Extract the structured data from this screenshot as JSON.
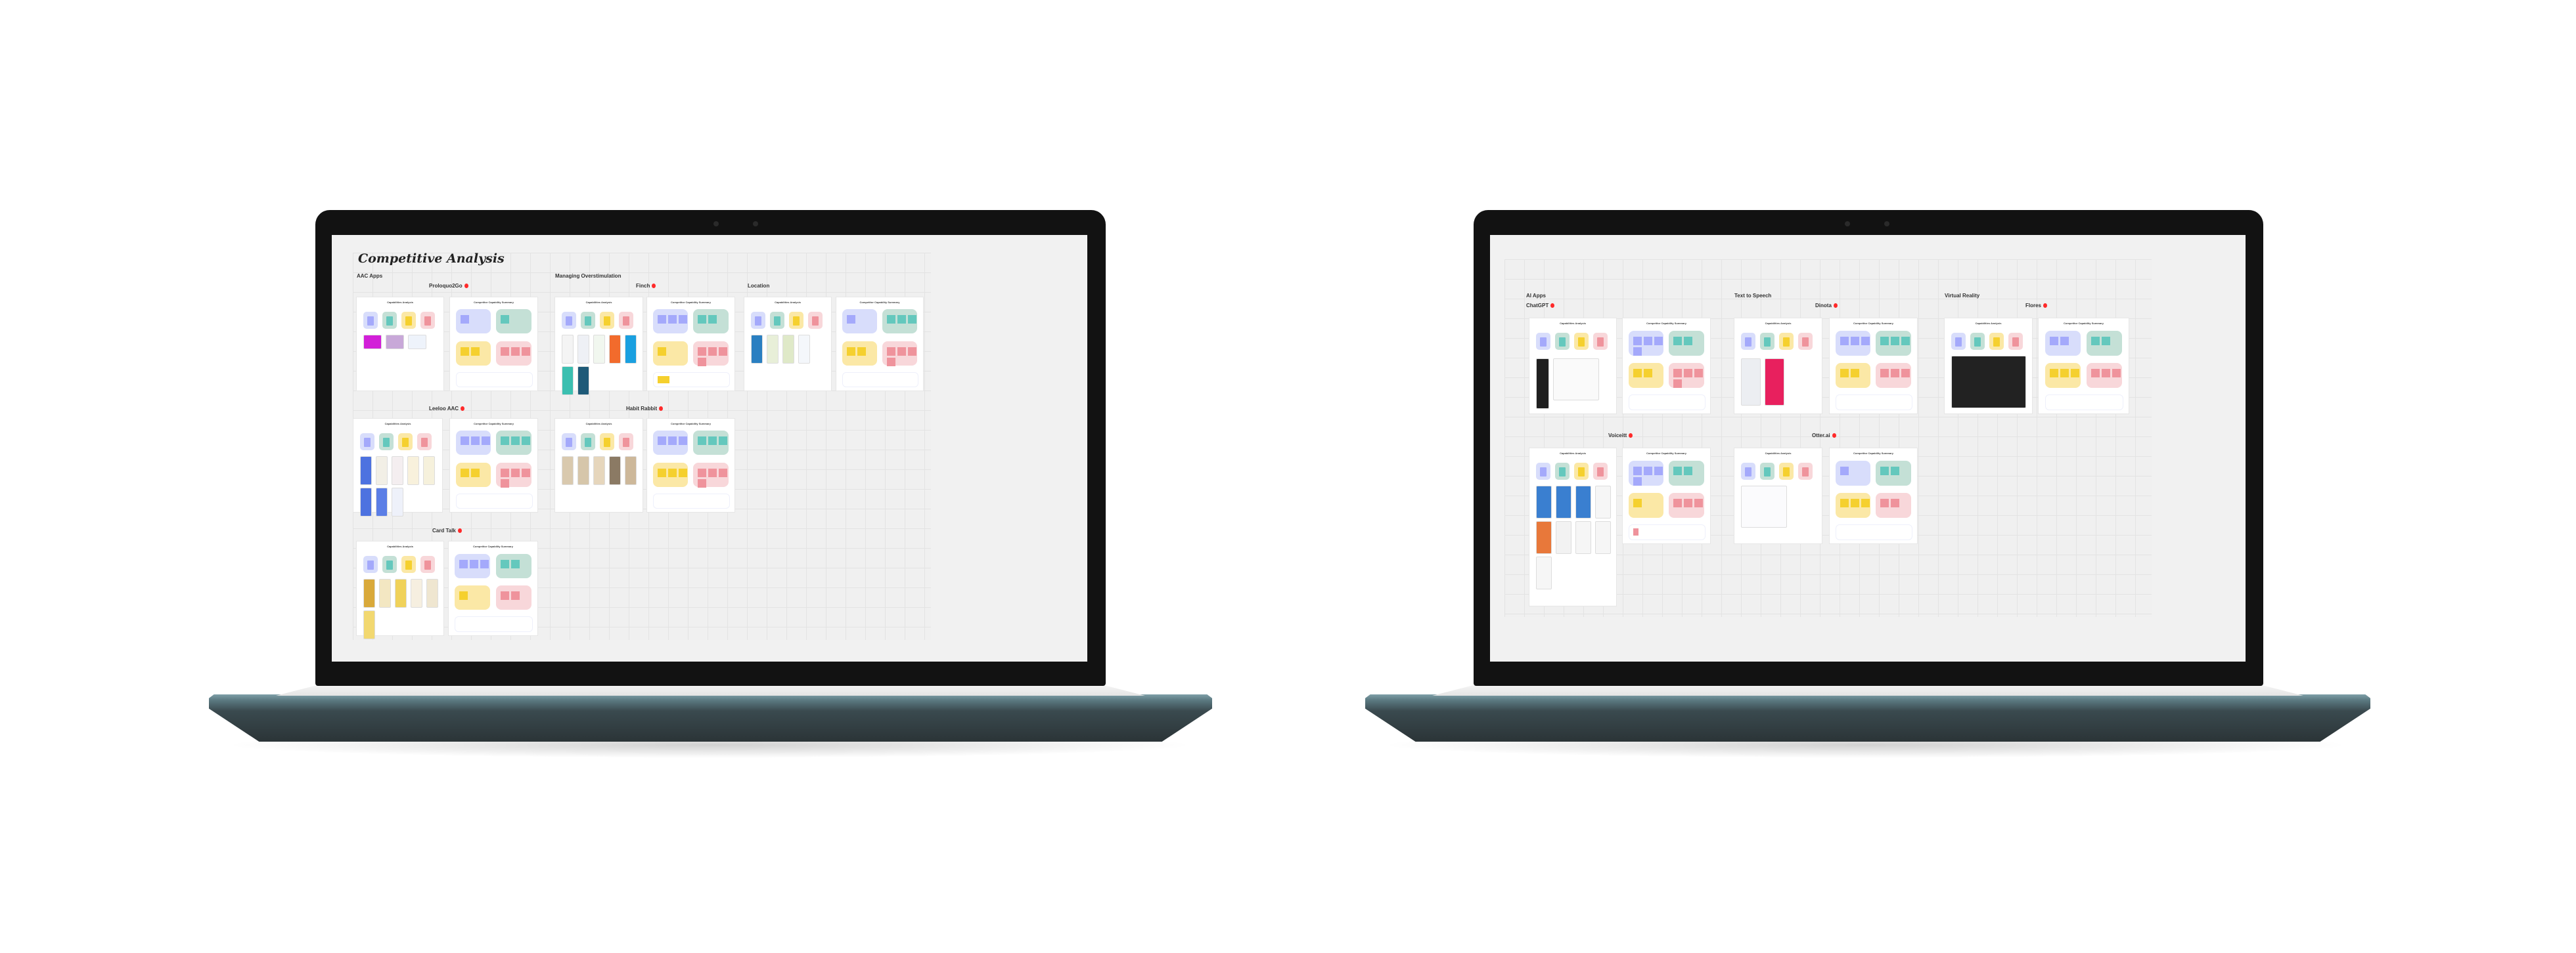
{
  "colors": {
    "blue_box": "#d8ddfb",
    "blue_note": "#a4a9fb",
    "green_box": "#c4e0d6",
    "green_note": "#64c8bd",
    "yellow_box": "#fbe8a6",
    "yellow_note": "#f5d02e",
    "red_box": "#f8d7da",
    "red_note": "#ef939c",
    "pin": "#ff2a2a"
  },
  "card_titles": {
    "capabilities": "Capabilities Analysis",
    "summary": "Competitor Capability Summary"
  },
  "laptops": [
    {
      "board": {
        "title": "Competitive Analysis",
        "sections": [
          {
            "label": "AAC Apps"
          },
          {
            "label": "Managing Overstimulation"
          }
        ],
        "groups": [
          {
            "name": "Proloquo2Go",
            "pin": true,
            "thumbs": [
              "stack:#d21fd8",
              "stack:#c8a8d8",
              "stack:#eef3fb"
            ],
            "summary": {
              "blue": 1,
              "green": 1,
              "yellow": 2,
              "red": 3,
              "notes": 0
            }
          },
          {
            "name": "Finch",
            "pin": true,
            "thumbs": [
              "phone:#f4f4f4",
              "phone:#eef0f5",
              "phone:#f1f7ef",
              "phone:#f26b2c",
              "phone:#1aa0e0",
              "phone:#3bbfb0",
              "phone:#1e5a78"
            ],
            "summary": {
              "blue": 3,
              "green": 2,
              "yellow": 1,
              "red": 4,
              "notes": 1
            }
          },
          {
            "name": "Location",
            "pin": false,
            "thumbs": [
              "phone:#2a7fc1",
              "phone:#e8efd8",
              "phone:#dfe9c8",
              "phone:#f4f7fb"
            ],
            "summary": {
              "blue": 1,
              "green": 3,
              "yellow": 2,
              "red": 4,
              "notes": 0
            }
          },
          {
            "name": "Leeloo AAC",
            "pin": true,
            "thumbs": [
              "phone:#4d72e0",
              "phone:#f2efe6",
              "phone:#f4eef0",
              "phone:#f8f1dc",
              "phone:#f6f1dc",
              "phone:#4d72e0",
              "phone:#5b7ee6",
              "phone:#eef1fa"
            ],
            "summary": {
              "blue": 3,
              "green": 3,
              "yellow": 2,
              "red": 4,
              "notes": 0
            }
          },
          {
            "name": "Habit Rabbit",
            "pin": true,
            "thumbs": [
              "phone:#d9c9ae",
              "phone:#d6c6aa",
              "phone:#e6d6bc",
              "phone:#8b7a64",
              "phone:#cdb89a"
            ],
            "summary": {
              "blue": 3,
              "green": 3,
              "yellow": 3,
              "red": 4,
              "notes": 0
            }
          },
          {
            "name": "Card Talk",
            "pin": true,
            "thumbs": [
              "phone:#d9a93a",
              "phone:#f3e7c2",
              "phone:#f0d25a",
              "phone:#f6efe0",
              "phone:#efe6d0",
              "phone:#f2d870"
            ],
            "summary": {
              "blue": 3,
              "green": 2,
              "yellow": 1,
              "red": 2,
              "notes": 0
            }
          }
        ]
      }
    },
    {
      "board": {
        "title": "",
        "sections": [
          {
            "label": "AI Apps"
          },
          {
            "label": "Text to Speech"
          },
          {
            "label": "Virtual Reality"
          }
        ],
        "groups": [
          {
            "name": "ChatGPT",
            "pin": true,
            "thumbs": [
              "tall:#1f1f1f",
              "wide:#fafafa"
            ],
            "summary": {
              "blue": 4,
              "green": 2,
              "yellow": 2,
              "red": 4,
              "notes": 0
            }
          },
          {
            "name": "Dinota",
            "pin": true,
            "thumbs": [
              "phone2:#eceef2",
              "phone2:#e8205e"
            ],
            "summary": {
              "blue": 3,
              "green": 3,
              "yellow": 2,
              "red": 3,
              "notes": 0
            }
          },
          {
            "name": "Flores",
            "pin": true,
            "thumbs": [
              "large:#222222"
            ],
            "summary": {
              "blue": 2,
              "green": 2,
              "yellow": 3,
              "red": 3,
              "notes": 0
            }
          },
          {
            "name": "Voiceitt",
            "pin": true,
            "thumbs": [
              "phone3:#3a7fd0",
              "phone3:#3a7fd0",
              "phone3:#3a7fd0",
              "phone3:#f6f6f6",
              "phone3:#e8783a",
              "phone3:#f2f2f2",
              "phone3:#f6f6f6",
              "phone3:#f6f6f6",
              "phone3:#f6f6f6"
            ],
            "summary": {
              "blue": 4,
              "green": 2,
              "yellow": 1,
              "red": 3,
              "notes": 1
            }
          },
          {
            "name": "Otter.ai",
            "pin": true,
            "thumbs": [
              "wide:#fbfbfd"
            ],
            "summary": {
              "blue": 1,
              "green": 2,
              "yellow": 3,
              "red": 2,
              "notes": 0
            }
          }
        ]
      }
    }
  ]
}
